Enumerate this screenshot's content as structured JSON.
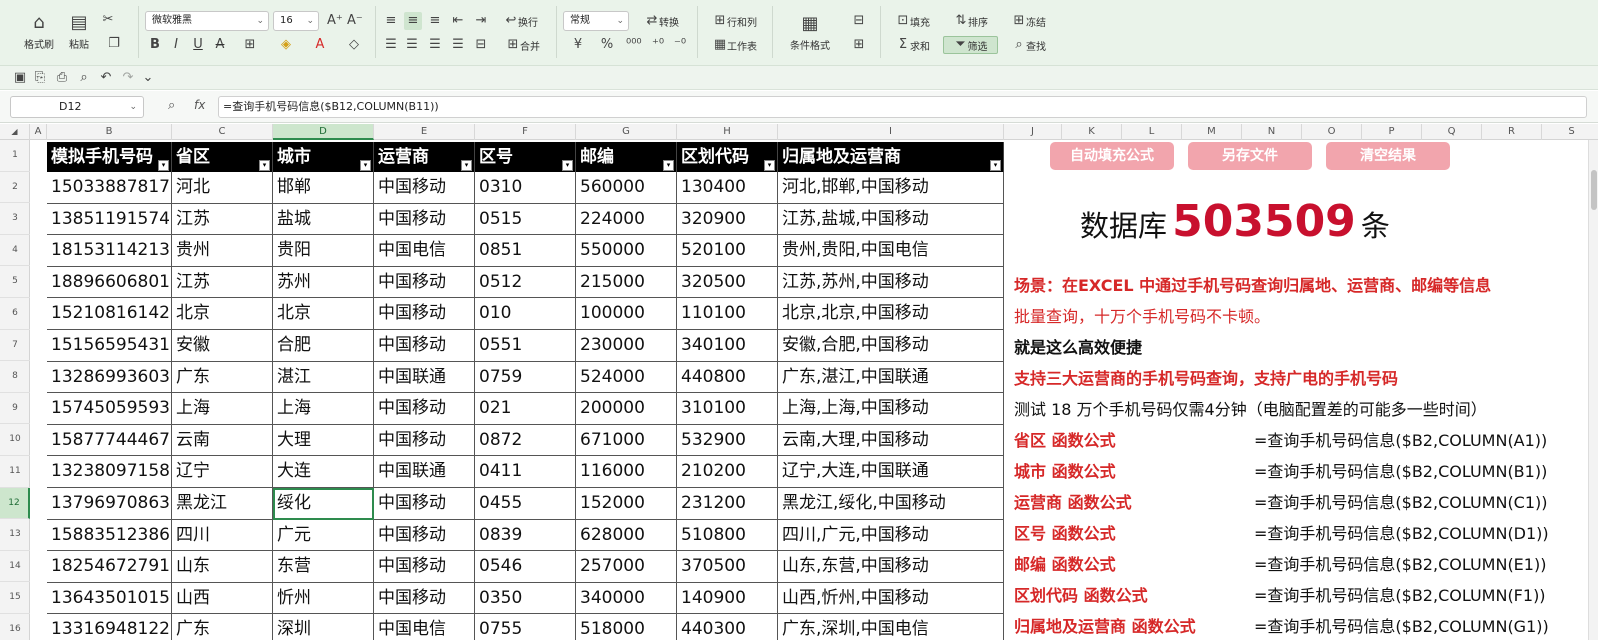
{
  "ribbon": {
    "format_painter": "格式刷",
    "paste": "粘贴",
    "font_name": "微软雅黑",
    "font_size": "16",
    "wrap": "换行",
    "number_format": "常规",
    "convert": "转换",
    "row_col": "行和列",
    "merge": "合并",
    "worksheet": "工作表",
    "cond_format": "条件格式",
    "fill": "填充",
    "sort": "排序",
    "freeze": "冻结",
    "sum": "求和",
    "filter": "筛选",
    "find": "查找"
  },
  "formula_bar": {
    "name_box": "D12",
    "fx_label": "fx",
    "formula": "=查询手机号码信息($B12,COLUMN(B11))"
  },
  "columns": [
    "A",
    "B",
    "C",
    "D",
    "E",
    "F",
    "G",
    "H",
    "I",
    "J",
    "K",
    "L",
    "M",
    "N",
    "O",
    "P",
    "Q",
    "R",
    "S"
  ],
  "active_column": "D",
  "rows": [
    "1",
    "2",
    "3",
    "4",
    "5",
    "6",
    "7",
    "8",
    "9",
    "10",
    "11",
    "12",
    "13",
    "14",
    "15",
    "16"
  ],
  "active_row": "12",
  "table": {
    "headers": [
      "模拟手机号码",
      "省区",
      "城市",
      "运营商",
      "区号",
      "邮编",
      "区划代码",
      "归属地及运营商"
    ],
    "rows": [
      [
        "15033887817",
        "河北",
        "邯郸",
        "中国移动",
        "0310",
        "560000",
        "130400",
        "河北,邯郸,中国移动"
      ],
      [
        "13851191574",
        "江苏",
        "盐城",
        "中国移动",
        "0515",
        "224000",
        "320900",
        "江苏,盐城,中国移动"
      ],
      [
        "18153114213",
        "贵州",
        "贵阳",
        "中国电信",
        "0851",
        "550000",
        "520100",
        "贵州,贵阳,中国电信"
      ],
      [
        "18896606801",
        "江苏",
        "苏州",
        "中国移动",
        "0512",
        "215000",
        "320500",
        "江苏,苏州,中国移动"
      ],
      [
        "15210816142",
        "北京",
        "北京",
        "中国移动",
        "010",
        "100000",
        "110100",
        "北京,北京,中国移动"
      ],
      [
        "15156595431",
        "安徽",
        "合肥",
        "中国移动",
        "0551",
        "230000",
        "340100",
        "安徽,合肥,中国移动"
      ],
      [
        "13286993603",
        "广东",
        "湛江",
        "中国联通",
        "0759",
        "524000",
        "440800",
        "广东,湛江,中国联通"
      ],
      [
        "15745059593",
        "上海",
        "上海",
        "中国移动",
        "021",
        "200000",
        "310100",
        "上海,上海,中国移动"
      ],
      [
        "15877744467",
        "云南",
        "大理",
        "中国移动",
        "0872",
        "671000",
        "532900",
        "云南,大理,中国移动"
      ],
      [
        "13238097158",
        "辽宁",
        "大连",
        "中国联通",
        "0411",
        "116000",
        "210200",
        "辽宁,大连,中国联通"
      ],
      [
        "13796970863",
        "黑龙江",
        "绥化",
        "中国移动",
        "0455",
        "152000",
        "231200",
        "黑龙江,绥化,中国移动"
      ],
      [
        "15883512386",
        "四川",
        "广元",
        "中国移动",
        "0839",
        "628000",
        "510800",
        "四川,广元,中国移动"
      ],
      [
        "18254672791",
        "山东",
        "东营",
        "中国移动",
        "0546",
        "257000",
        "370500",
        "山东,东营,中国移动"
      ],
      [
        "13643501015",
        "山西",
        "忻州",
        "中国移动",
        "0350",
        "340000",
        "140900",
        "山西,忻州,中国移动"
      ],
      [
        "13316948122",
        "广东",
        "深圳",
        "中国电信",
        "0755",
        "518000",
        "440300",
        "广东,深圳,中国电信"
      ]
    ]
  },
  "panel": {
    "buttons": [
      "自动填充公式",
      "另存文件",
      "清空结果"
    ],
    "db_prefix": "数据库",
    "db_count": "503509",
    "db_suffix": "条",
    "lines": [
      {
        "text": "场景：在EXCEL 中通过手机号码查询归属地、运营商、邮编等信息",
        "style": "red"
      },
      {
        "text": "批量查询，十万个手机号码不卡顿。",
        "style": "red-light"
      },
      {
        "text": "就是这么高效便捷",
        "style": "bold"
      },
      {
        "text": "支持三大运营商的手机号码查询，支持广电的手机号码",
        "style": "red"
      },
      {
        "text": "测试 18 万个手机号码仅需4分钟（电脑配置差的可能多一些时间）",
        "style": "normal"
      }
    ],
    "formulas": [
      {
        "label": "省区 函数公式",
        "formula": "=查询手机号码信息($B2,COLUMN(A1))"
      },
      {
        "label": "城市 函数公式",
        "formula": "=查询手机号码信息($B2,COLUMN(B1))"
      },
      {
        "label": "运营商 函数公式",
        "formula": "=查询手机号码信息($B2,COLUMN(C1))"
      },
      {
        "label": "区号 函数公式",
        "formula": "=查询手机号码信息($B2,COLUMN(D1))"
      },
      {
        "label": "邮编 函数公式",
        "formula": "=查询手机号码信息($B2,COLUMN(E1))"
      },
      {
        "label": "区划代码 函数公式",
        "formula": "=查询手机号码信息($B2,COLUMN(F1))"
      },
      {
        "label": "归属地及运营商 函数公式",
        "formula": "=查询手机号码信息($B2,COLUMN(G1))"
      }
    ]
  },
  "colors": {
    "accent_green": "#2e8b4e",
    "header_black": "#000000",
    "button_pink": "#f2a5ad",
    "db_red": "#c8102e",
    "label_red": "#d62828"
  }
}
